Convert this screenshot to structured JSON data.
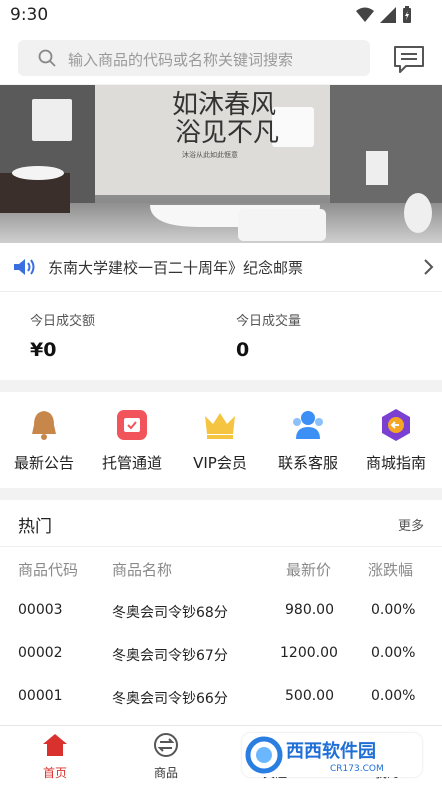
{
  "status_bar": {
    "time": "9:30"
  },
  "search": {
    "placeholder": "输入商品的代码或名称关键词搜索"
  },
  "banner": {
    "headline_line1": "如沐春风",
    "headline_line2": "浴见不凡",
    "tagline": "沐浴从此如此惬意"
  },
  "notice": {
    "text": "东南大学建校一百二十周年》纪念邮票"
  },
  "stats": {
    "turnover_label": "今日成交额",
    "turnover_value": "¥0",
    "volume_label": "今日成交量",
    "volume_value": "0"
  },
  "menu": {
    "items": [
      {
        "label": "最新公告",
        "icon": "bell-icon",
        "color": "#c8874a"
      },
      {
        "label": "托管通道",
        "icon": "calendar-icon",
        "color": "#f2545b"
      },
      {
        "label": "VIP会员",
        "icon": "crown-icon",
        "color": "#f5c542"
      },
      {
        "label": "联系客服",
        "icon": "users-icon",
        "color": "#3b8ff5"
      },
      {
        "label": "商城指南",
        "icon": "guide-icon",
        "color": "#7b3fd1"
      }
    ]
  },
  "hot": {
    "title": "热门",
    "more": "更多",
    "columns": [
      "商品代码",
      "商品名称",
      "最新价",
      "涨跌幅"
    ],
    "rows": [
      {
        "code": "00003",
        "name": "冬奥会司令钞68分",
        "price": "980.00",
        "change": "0.00%"
      },
      {
        "code": "00002",
        "name": "冬奥会司令钞67分",
        "price": "1200.00",
        "change": "0.00%"
      },
      {
        "code": "00001",
        "name": "冬奥会司令钞66分",
        "price": "500.00",
        "change": "0.00%"
      }
    ]
  },
  "tabbar": {
    "active_color": "#d9322e",
    "items": [
      {
        "label": "首页",
        "icon": "home-icon"
      },
      {
        "label": "商品",
        "icon": "exchange-icon"
      },
      {
        "label": "关注",
        "icon": "heart-icon"
      },
      {
        "label": "我的",
        "icon": "user-icon"
      }
    ]
  },
  "watermark": {
    "brand": "西西软件园",
    "domain": "CR173.COM"
  }
}
